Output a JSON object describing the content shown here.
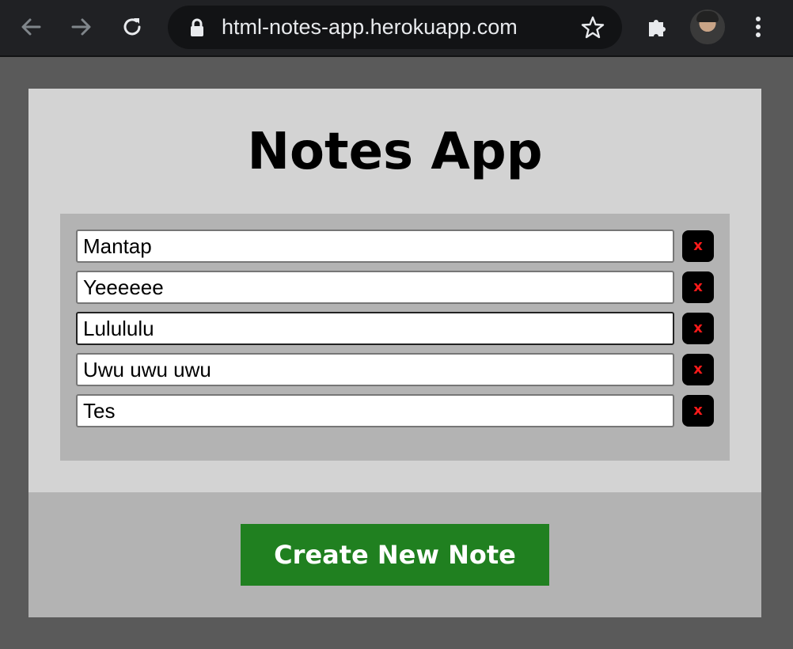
{
  "browser": {
    "url": "html-notes-app.herokuapp.com",
    "icons": [
      "back-arrow-icon",
      "forward-arrow-icon",
      "reload-icon",
      "lock-icon",
      "star-icon",
      "extensions-icon",
      "avatar",
      "menu-icon"
    ]
  },
  "app": {
    "title": "Notes App",
    "notes": [
      {
        "text": "Mantap",
        "delete_label": "x"
      },
      {
        "text": "Yeeeeee",
        "delete_label": "x"
      },
      {
        "text": "Lulululu",
        "delete_label": "x"
      },
      {
        "text": "Uwu uwu uwu",
        "delete_label": "x"
      },
      {
        "text": "Tes",
        "delete_label": "x"
      }
    ],
    "create_button_label": "Create New Note"
  },
  "colors": {
    "page_background": "#5a5a5a",
    "app_background": "#d3d3d3",
    "panel_background": "#b3b3b3",
    "create_button": "#208020",
    "delete_button": "#000000",
    "delete_x": "#ff1a1a"
  }
}
